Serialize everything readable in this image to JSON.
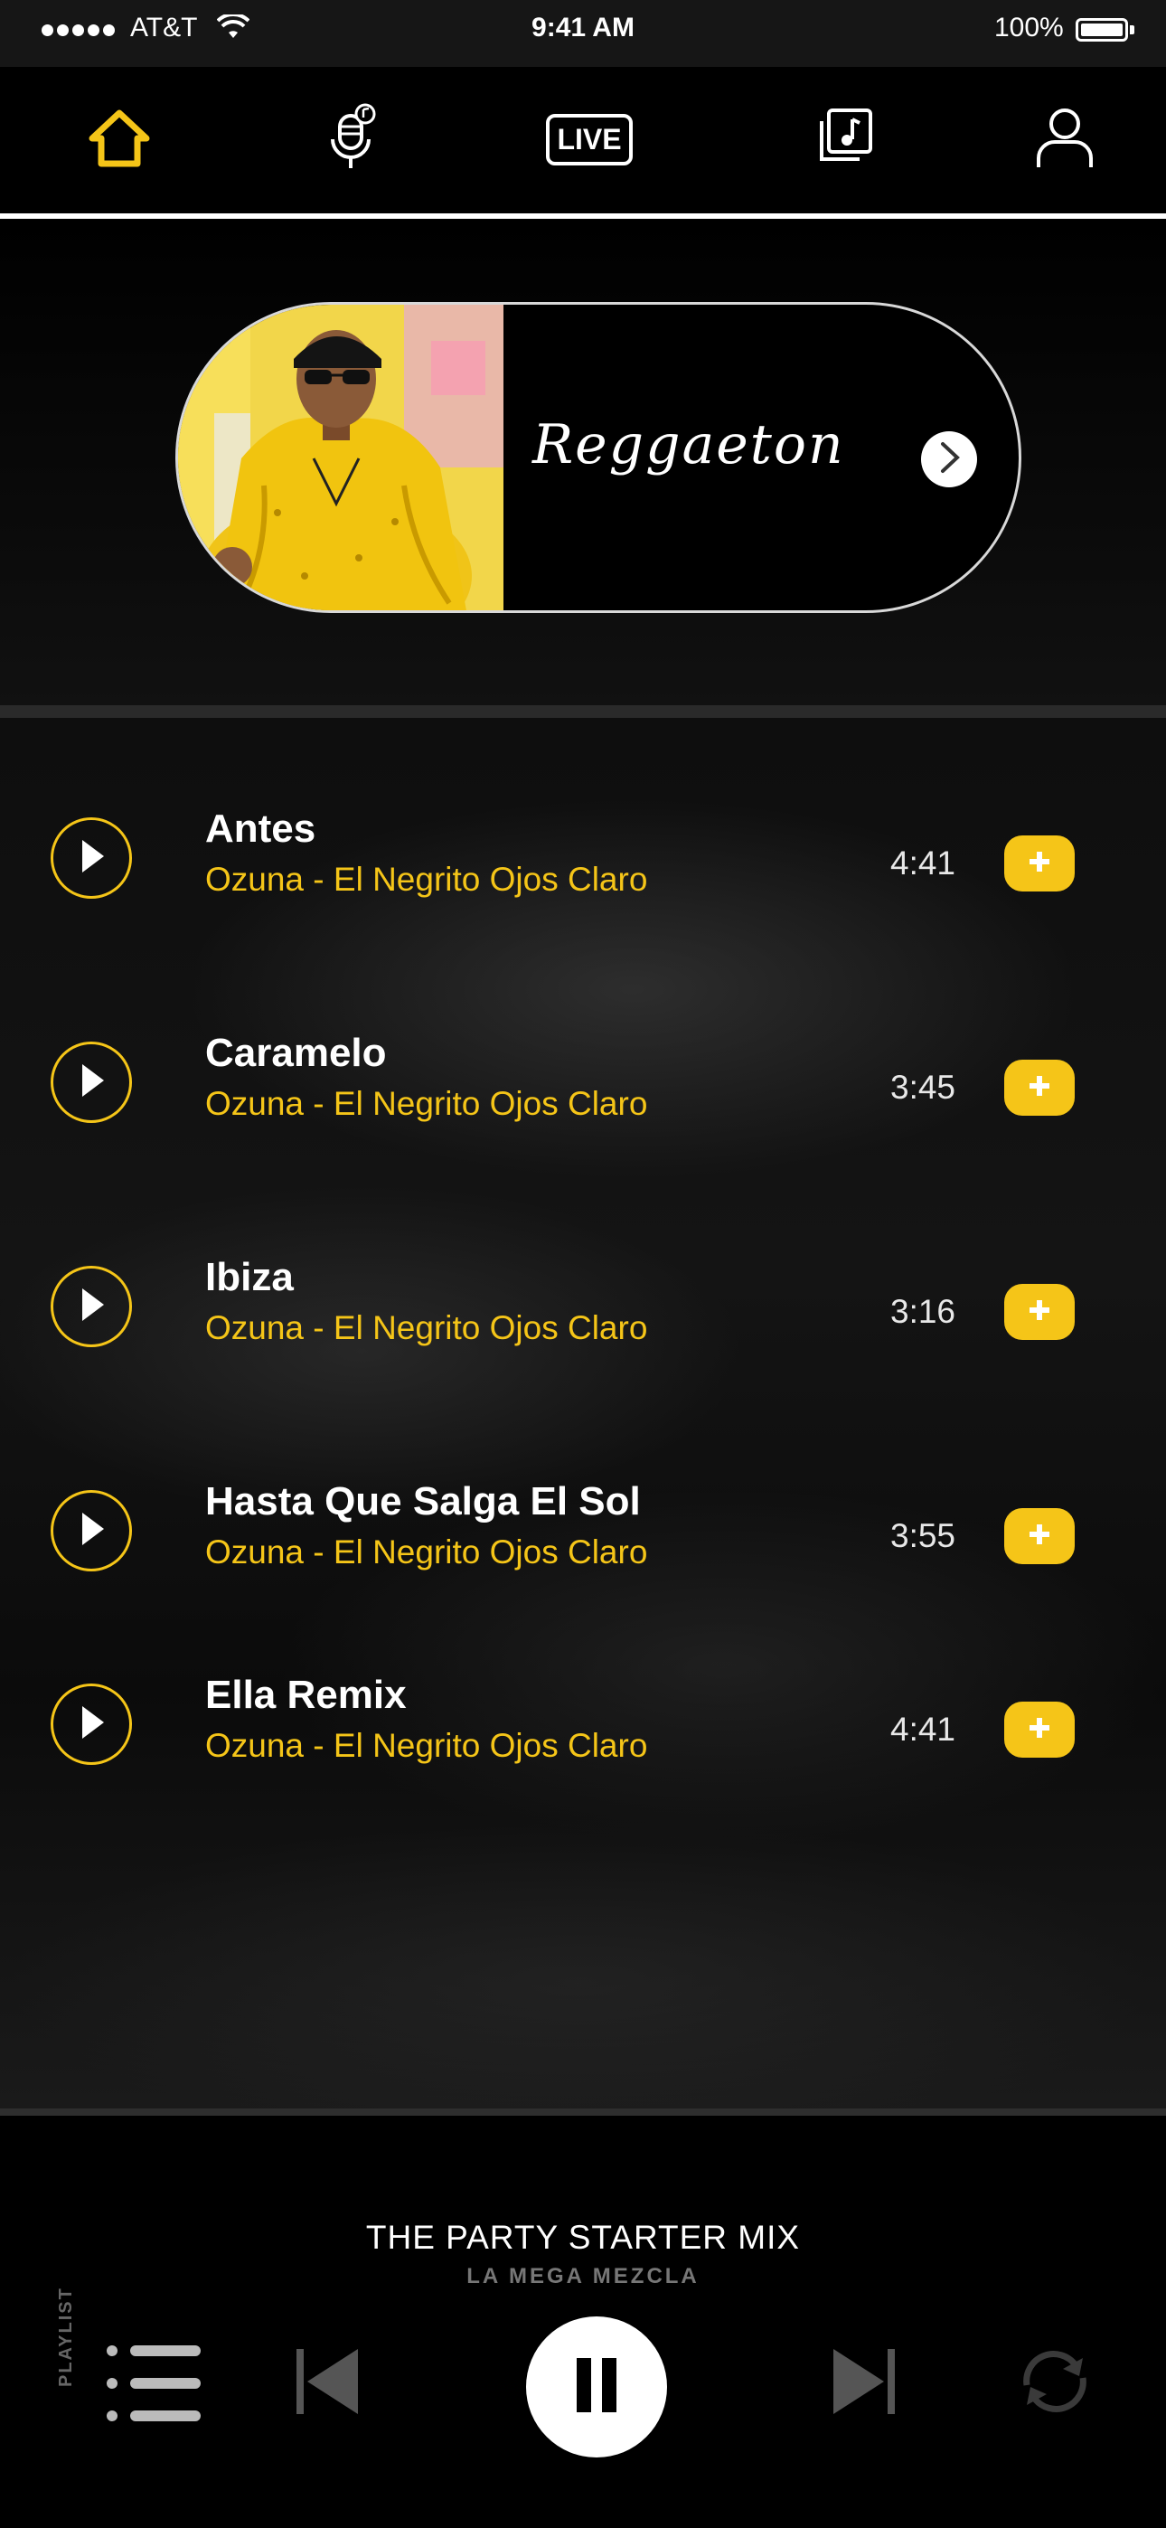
{
  "status_bar": {
    "carrier": "AT&T",
    "time": "9:41 AM",
    "battery": "100%"
  },
  "nav": {
    "items": [
      {
        "name": "home",
        "label": ""
      },
      {
        "name": "podcast",
        "label": ""
      },
      {
        "name": "live",
        "label": "LIVE"
      },
      {
        "name": "library",
        "label": ""
      },
      {
        "name": "profile",
        "label": ""
      }
    ],
    "active": "home"
  },
  "banner": {
    "title": "Reggaeton"
  },
  "tracks": [
    {
      "title": "Antes",
      "artist": "Ozuna - El Negrito Ojos Claro",
      "duration": "4:41"
    },
    {
      "title": "Caramelo",
      "artist": "Ozuna - El Negrito Ojos Claro",
      "duration": "3:45"
    },
    {
      "title": "Ibiza",
      "artist": "Ozuna - El Negrito Ojos Claro",
      "duration": "3:16"
    },
    {
      "title": "Hasta Que Salga El Sol",
      "artist": "Ozuna - El Negrito Ojos Claro",
      "duration": "3:55"
    },
    {
      "title": "Ella Remix",
      "artist": "Ozuna - El Negrito Ojos Claro",
      "duration": "4:41"
    }
  ],
  "player": {
    "title": "THE PARTY STARTER MIX",
    "subtitle": "LA MEGA MEZCLA",
    "playlist_label": "PLAYLIST"
  },
  "colors": {
    "accent": "#f5c518",
    "background": "#000000",
    "text": "#ffffff",
    "muted": "#777777"
  }
}
